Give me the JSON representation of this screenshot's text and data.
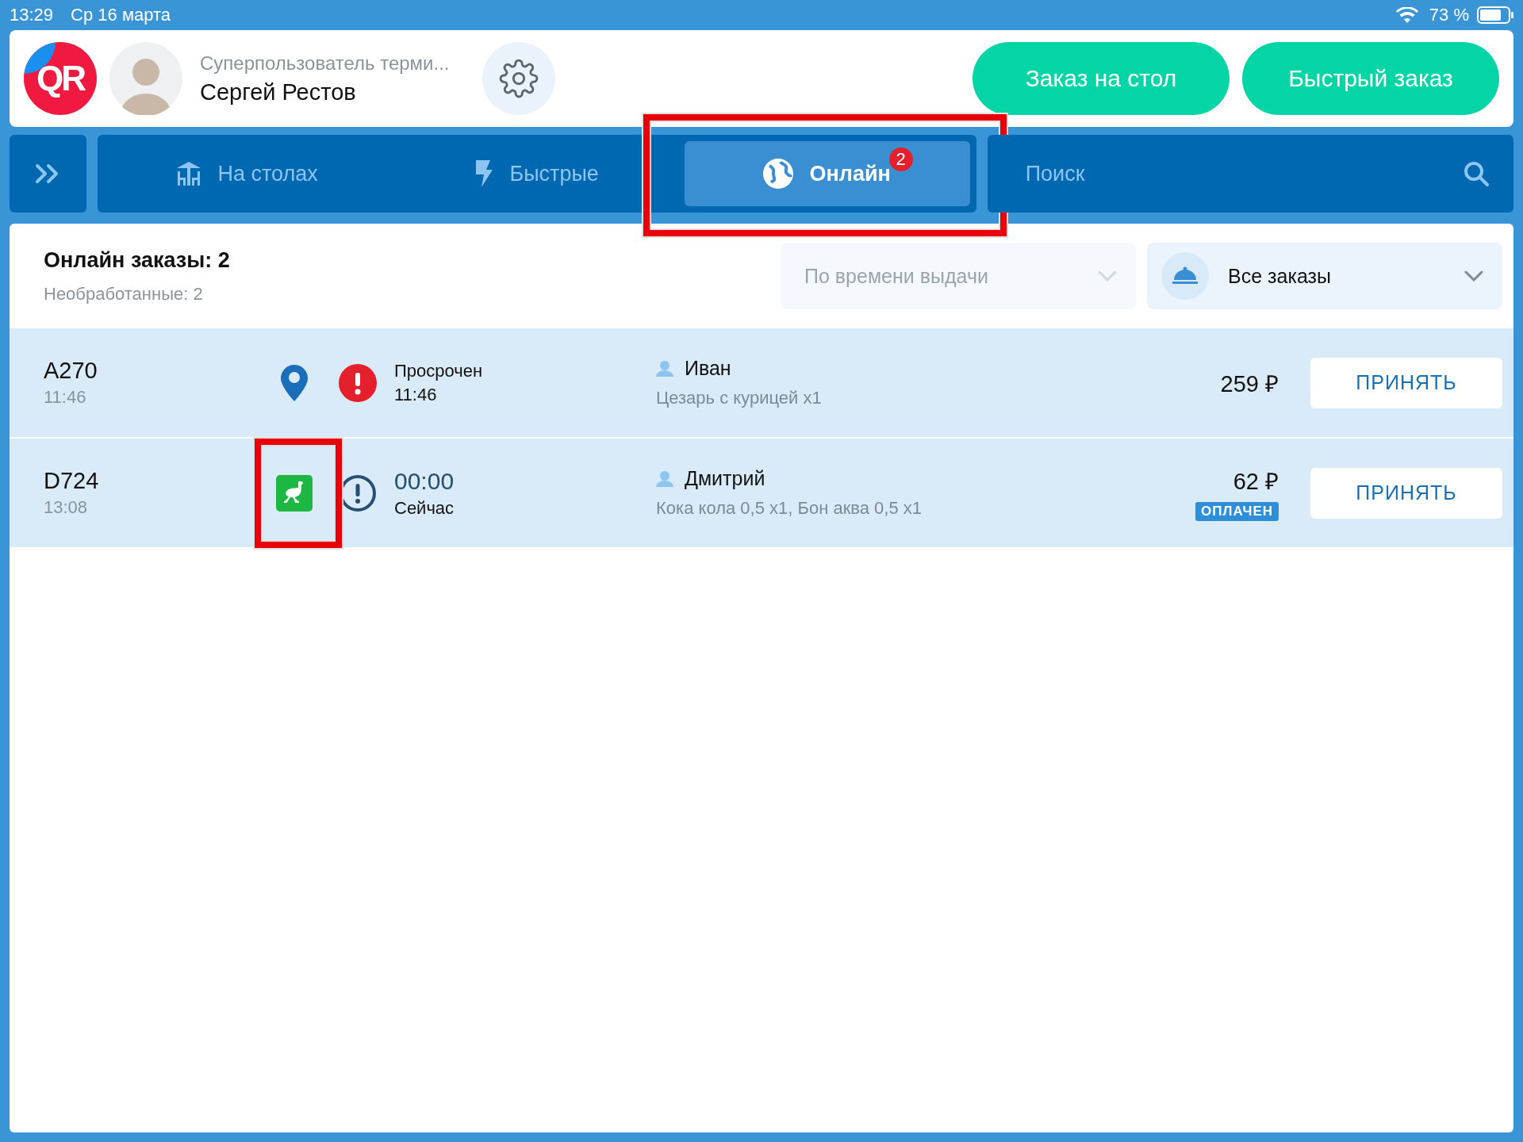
{
  "status_bar": {
    "time": "13:29",
    "date": "Ср 16 марта",
    "battery": "73 %"
  },
  "header": {
    "logo": "QR",
    "role": "Суперпользователь терми...",
    "user": "Сергей Рестов",
    "buttons": [
      "Заказ на стол",
      "Быстрый заказ"
    ]
  },
  "tabs": [
    {
      "label": "На столах",
      "kind": "tables",
      "selected": false,
      "highlighted": false
    },
    {
      "label": "Быстрые",
      "kind": "quick",
      "selected": false,
      "highlighted": false
    },
    {
      "label": "Онлайн",
      "kind": "online",
      "selected": true,
      "highlighted": true,
      "badge": "2"
    }
  ],
  "search": {
    "placeholder": "Поиск"
  },
  "summary": {
    "title": "Онлайн заказы: 2",
    "subtitle": "Необработанные: 2"
  },
  "sort_dropdown": {
    "value": "По времени выдачи",
    "disabled": true
  },
  "filter_dropdown": {
    "value": "Все заказы",
    "disabled": false
  },
  "orders": [
    {
      "number": "A270",
      "time": "11:46",
      "source": {
        "kind": "pin",
        "highlighted": false
      },
      "status": {
        "kind": "overdue",
        "main": "Просрочен",
        "sub": "11:46"
      },
      "customer": "Иван",
      "items": "Цезарь с курицей x1",
      "price": "259 ₽",
      "button": "ПРИНЯТЬ"
    },
    {
      "number": "D724",
      "time": "13:08",
      "source": {
        "kind": "app",
        "highlighted": true
      },
      "status": {
        "kind": "upcoming",
        "main": "00:00",
        "sub": "Сейчас"
      },
      "customer": "Дмитрий",
      "items": "Кока кола 0,5 x1, Бон аква 0,5 x1",
      "price": "62 ₽",
      "paid": "ОПЛАЧЕН",
      "button": "ПРИНЯТЬ"
    }
  ]
}
